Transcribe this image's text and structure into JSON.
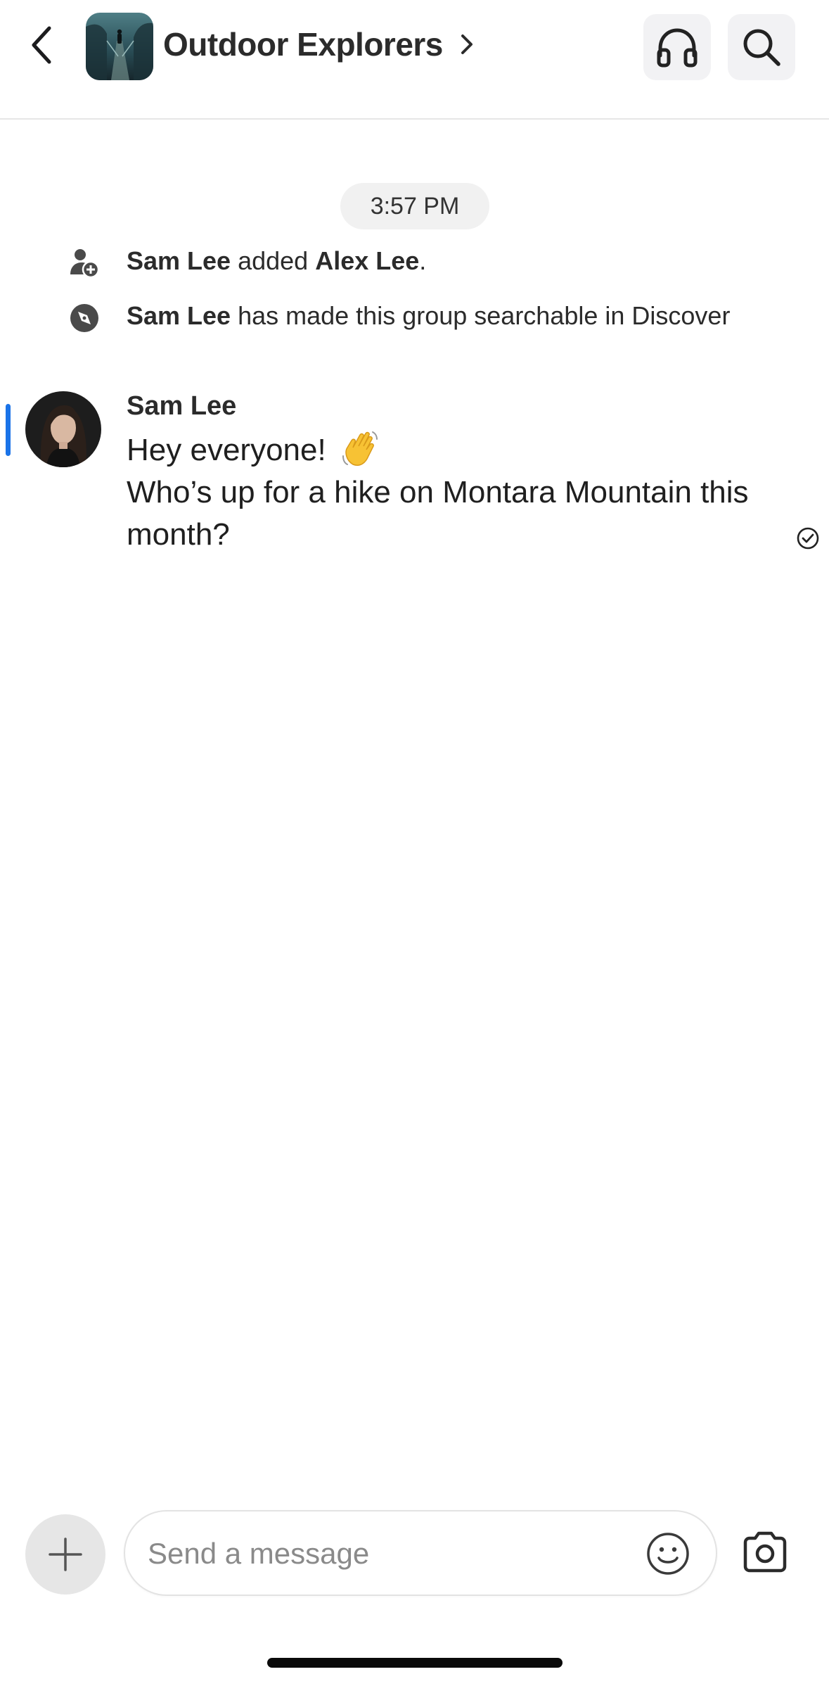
{
  "header": {
    "group_title": "Outdoor Explorers",
    "icons": {
      "back": "chevron-left-icon",
      "title_chevron": "chevron-right-icon",
      "audio": "headphones-icon",
      "search": "search-icon"
    }
  },
  "timeline": {
    "timestamp": "3:57 PM",
    "system_messages": [
      {
        "icon": "add-member-icon",
        "actor": "Sam Lee",
        "text": " added ",
        "target": "Alex Lee",
        "suffix": "."
      },
      {
        "icon": "compass-icon",
        "actor": "Sam Lee",
        "text": " has made this group searchable in Discover"
      }
    ],
    "message": {
      "sender": "Sam Lee",
      "line1": "Hey everyone!",
      "emoji": "👋",
      "line2": "Who’s up for a hike on Montara Mountain this month?",
      "status_icon": "read-check-icon"
    }
  },
  "composer": {
    "placeholder": "Send a message",
    "icons": {
      "add": "plus-icon",
      "emoji": "smiley-icon",
      "camera": "camera-icon"
    }
  },
  "colors": {
    "accent": "#1a73e8",
    "text": "#2b2b2b",
    "muted": "#8a8a8a",
    "pill": "#f1f1f1"
  }
}
